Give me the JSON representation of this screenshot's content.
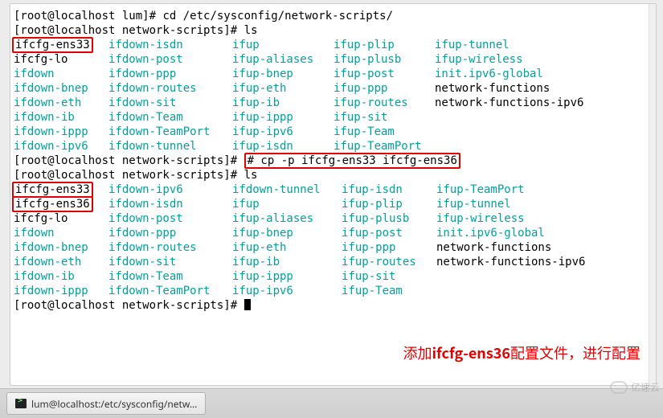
{
  "prompts": {
    "p1": "[root@localhost lum]# ",
    "p2": "[root@localhost network-scripts]# "
  },
  "cmds": {
    "cd": "cd /etc/sysconfig/network-scripts/",
    "ls": "ls",
    "cp": "# cp -p ifcfg-ens33 ifcfg-ens36"
  },
  "ls1": {
    "rows": [
      {
        "c1": "ifcfg-ens33",
        "c1hl": true,
        "c2": "ifdown-isdn",
        "c3": "ifup",
        "c4": "ifup-plip",
        "c5": "ifup-tunnel",
        "cls": [
          "blk",
          "cy",
          "cy",
          "cy",
          "cy"
        ]
      },
      {
        "c1": "ifcfg-lo",
        "c2": "ifdown-post",
        "c3": "ifup-aliases",
        "c4": "ifup-plusb",
        "c5": "ifup-wireless",
        "cls": [
          "blk",
          "cy",
          "cy",
          "cy",
          "cy"
        ]
      },
      {
        "c1": "ifdown",
        "c2": "ifdown-ppp",
        "c3": "ifup-bnep",
        "c4": "ifup-post",
        "c5": "init.ipv6-global",
        "cls": [
          "cy",
          "cy",
          "cy",
          "cy",
          "cy"
        ]
      },
      {
        "c1": "ifdown-bnep",
        "c2": "ifdown-routes",
        "c3": "ifup-eth",
        "c4": "ifup-ppp",
        "c5": "network-functions",
        "cls": [
          "cy",
          "cy",
          "cy",
          "cy",
          "blk"
        ]
      },
      {
        "c1": "ifdown-eth",
        "c2": "ifdown-sit",
        "c3": "ifup-ib",
        "c4": "ifup-routes",
        "c5": "network-functions-ipv6",
        "cls": [
          "cy",
          "cy",
          "cy",
          "cy",
          "blk"
        ]
      },
      {
        "c1": "ifdown-ib",
        "c2": "ifdown-Team",
        "c3": "ifup-ippp",
        "c4": "ifup-sit",
        "c5": "",
        "cls": [
          "cy",
          "cy",
          "cy",
          "cy",
          "blk"
        ]
      },
      {
        "c1": "ifdown-ippp",
        "c2": "ifdown-TeamPort",
        "c3": "ifup-ipv6",
        "c4": "ifup-Team",
        "c5": "",
        "cls": [
          "cy",
          "cy",
          "cy",
          "cy",
          "blk"
        ]
      },
      {
        "c1": "ifdown-ipv6",
        "c2": "ifdown-tunnel",
        "c3": "ifup-isdn",
        "c4": "ifup-TeamPort",
        "c5": "",
        "cls": [
          "cy",
          "cy",
          "cy",
          "cy",
          "blk"
        ]
      }
    ]
  },
  "ls2": {
    "rows": [
      {
        "c1": "ifcfg-ens33",
        "c1hl": true,
        "c2": "ifdown-ipv6",
        "c3": "ifdown-tunnel",
        "c4": "ifup-isdn",
        "c5": "ifup-TeamPort",
        "cls": [
          "blk",
          "cy",
          "cy",
          "cy",
          "cy"
        ]
      },
      {
        "c1": "ifcfg-ens36",
        "c1hl": true,
        "c2": "ifdown-isdn",
        "c3": "ifup",
        "c4": "ifup-plip",
        "c5": "ifup-tunnel",
        "cls": [
          "blk",
          "cy",
          "cy",
          "cy",
          "cy"
        ]
      },
      {
        "c1": "ifcfg-lo",
        "c2": "ifdown-post",
        "c3": "ifup-aliases",
        "c4": "ifup-plusb",
        "c5": "ifup-wireless",
        "cls": [
          "blk",
          "cy",
          "cy",
          "cy",
          "cy"
        ]
      },
      {
        "c1": "ifdown",
        "c2": "ifdown-ppp",
        "c3": "ifup-bnep",
        "c4": "ifup-post",
        "c5": "init.ipv6-global",
        "cls": [
          "cy",
          "cy",
          "cy",
          "cy",
          "cy"
        ]
      },
      {
        "c1": "ifdown-bnep",
        "c2": "ifdown-routes",
        "c3": "ifup-eth",
        "c4": "ifup-ppp",
        "c5": "network-functions",
        "cls": [
          "cy",
          "cy",
          "cy",
          "cy",
          "blk"
        ]
      },
      {
        "c1": "ifdown-eth",
        "c2": "ifdown-sit",
        "c3": "ifup-ib",
        "c4": "ifup-routes",
        "c5": "network-functions-ipv6",
        "cls": [
          "cy",
          "cy",
          "cy",
          "cy",
          "blk"
        ]
      },
      {
        "c1": "ifdown-ib",
        "c2": "ifdown-Team",
        "c3": "ifup-ippp",
        "c4": "ifup-sit",
        "c5": "",
        "cls": [
          "cy",
          "cy",
          "cy",
          "cy",
          "blk"
        ]
      },
      {
        "c1": "ifdown-ippp",
        "c2": "ifdown-TeamPort",
        "c3": "ifup-ipv6",
        "c4": "ifup-Team",
        "c5": "",
        "cls": [
          "cy",
          "cy",
          "cy",
          "cy",
          "blk"
        ]
      }
    ]
  },
  "note": {
    "prefix": "添加",
    "bold": "ifcfg-ens36",
    "suffix": "配置文件，进行配置"
  },
  "taskbar": {
    "title": "lum@localhost:/etc/sysconfig/netw…"
  },
  "watermark": "亿速云"
}
